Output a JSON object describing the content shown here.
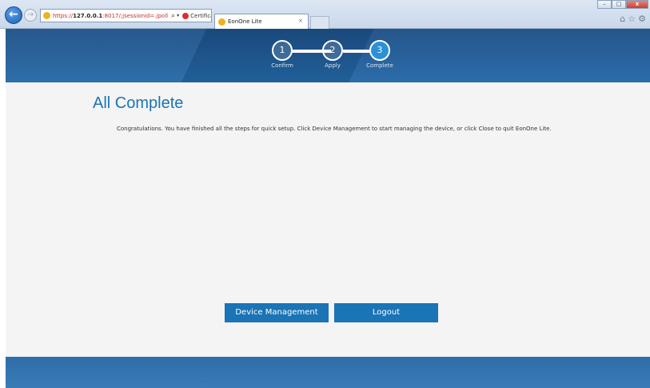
{
  "browser": {
    "url_prefix": "https://",
    "url_host": "127.0.0.1",
    "url_rest": ":8017/;jsessionid=.jpoll",
    "certificate_error": "Certificate error",
    "tab_title": "EonOne Lite",
    "tab_close": "×",
    "back": "←",
    "forward": "→",
    "search": "⌕",
    "dropdown": "▾",
    "refresh": "↻",
    "window_min": "–",
    "window_max": "□",
    "window_close": "x",
    "toolbar_icons": "⌂☆⚙"
  },
  "stepper": {
    "steps": [
      {
        "number": "1",
        "label": "Confirm"
      },
      {
        "number": "2",
        "label": "Apply"
      },
      {
        "number": "3",
        "label": "Complete"
      }
    ],
    "active_step": 3
  },
  "content": {
    "title": "All Complete",
    "message": "Congratulations. You have finished all the steps for quick setup. Click Device Management to start managing the device, or click Close to quit EonOne Lite."
  },
  "actions": {
    "device_management": "Device Management",
    "logout": "Logout"
  },
  "colors": {
    "accent": "#1a74b5",
    "header": "#1c4f86",
    "footer": "#2e6da9"
  }
}
